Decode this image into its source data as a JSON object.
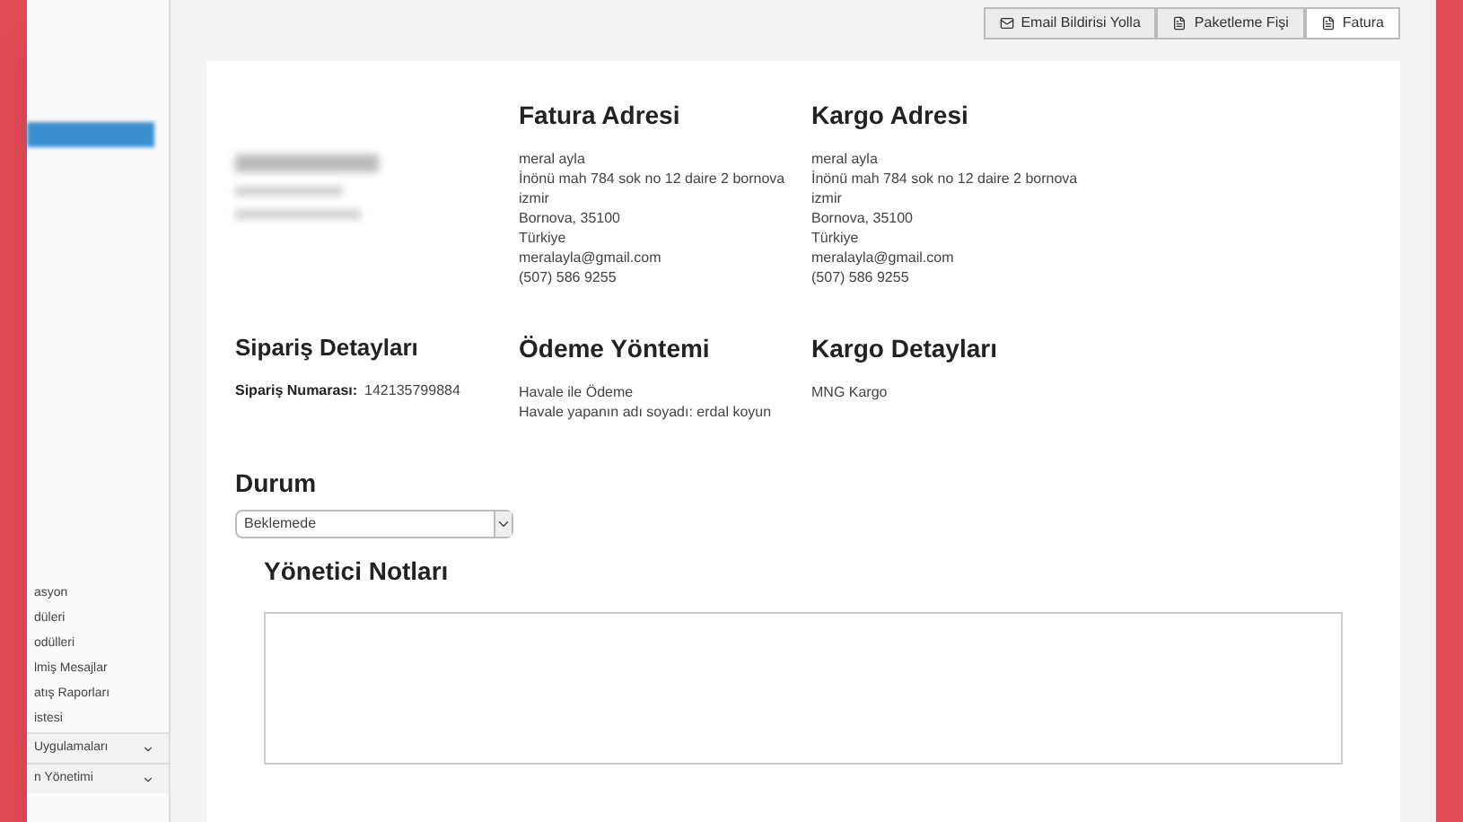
{
  "toolbar": {
    "buttons": [
      {
        "label": "Email Bildirisi Yolla",
        "kind": "email",
        "selected": false
      },
      {
        "label": "Paketleme Fişi",
        "kind": "doc",
        "selected": false
      },
      {
        "label": "Fatura",
        "kind": "doc",
        "selected": true
      }
    ]
  },
  "sidebar": {
    "items": [
      {
        "label": "asyon",
        "caret": false
      },
      {
        "label": "düleri",
        "caret": false
      },
      {
        "label": "odülleri",
        "caret": false
      },
      {
        "label": "lmiş Mesajlar",
        "caret": false
      },
      {
        "label": "atış Raporları",
        "caret": false
      },
      {
        "label": "istesi",
        "caret": false
      },
      {
        "label": "Uygulamaları",
        "caret": true
      },
      {
        "label": "n Yönetimi",
        "caret": true
      }
    ]
  },
  "addresses": [
    {
      "title": "Fatura Adresi",
      "lines": [
        "meral ayla",
        "İnönü mah 784 sok no 12 daire 2 bornova",
        "izmir",
        "Bornova, 35100",
        "Türkiye",
        "meralayla@gmail.com",
        "(507) 586 9255"
      ]
    },
    {
      "title": "Kargo Adresi",
      "lines": [
        "meral ayla",
        "İnönü mah 784 sok no 12 daire 2 bornova",
        "izmir",
        "Bornova, 35100",
        "Türkiye",
        "meralayla@gmail.com",
        "(507) 586 9255"
      ]
    }
  ],
  "order_details": {
    "title": "Sipariş Detayları",
    "number_label": "Sipariş Numarası:",
    "number": "142135799884"
  },
  "payment": {
    "title": "Ödeme Yöntemi",
    "lines": [
      "Havale ile Ödeme",
      "Havale yapanın adı soyadı: erdal koyun"
    ]
  },
  "shipping": {
    "title": "Kargo Detayları",
    "lines": [
      "MNG Kargo"
    ]
  },
  "status": {
    "title": "Durum",
    "value": "Beklemede"
  },
  "notes": {
    "title": "Yönetici Notları"
  }
}
